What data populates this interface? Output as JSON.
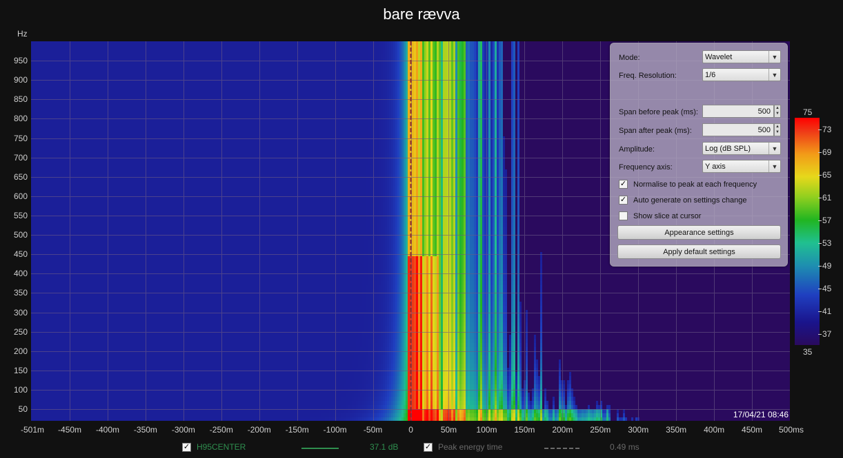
{
  "title": "bare rævva",
  "y_unit": "Hz",
  "timestamp": "17/04/21 08:46",
  "chart_data": {
    "type": "heatmap",
    "title": "bare rævva",
    "xlabel": "",
    "ylabel": "Hz",
    "x_ticks": [
      "-501m",
      "-450m",
      "-400m",
      "-350m",
      "-300m",
      "-250m",
      "-200m",
      "-150m",
      "-100m",
      "-50m",
      "0",
      "50m",
      "100m",
      "150m",
      "200m",
      "250m",
      "300m",
      "350m",
      "400m",
      "450m",
      "500ms"
    ],
    "xlim": [
      -501,
      500
    ],
    "y_ticks": [
      50,
      100,
      150,
      200,
      250,
      300,
      350,
      400,
      450,
      500,
      550,
      600,
      650,
      700,
      750,
      800,
      850,
      900,
      950
    ],
    "ylim": [
      20,
      1000
    ],
    "color_scale": {
      "min": 35,
      "max": 75,
      "ticks": [
        37,
        41,
        45,
        49,
        53,
        57,
        61,
        65,
        69,
        73
      ]
    },
    "grid": true
  },
  "panel": {
    "mode": {
      "label": "Mode:",
      "value": "Wavelet"
    },
    "freq_resolution": {
      "label": "Freq. Resolution:",
      "value": "1/6"
    },
    "span_before": {
      "label": "Span before peak (ms):",
      "value": "500"
    },
    "span_after": {
      "label": "Span after peak (ms):",
      "value": "500"
    },
    "amplitude": {
      "label": "Amplitude:",
      "value": "Log (dB SPL)"
    },
    "freq_axis": {
      "label": "Frequency axis:",
      "value": "Y axis"
    },
    "normalise": {
      "label": "Normalise to peak at each frequency",
      "checked": true
    },
    "auto_generate": {
      "label": "Auto generate on settings change",
      "checked": true
    },
    "show_slice": {
      "label": "Show slice at cursor",
      "checked": false
    },
    "appearance_btn": "Appearance settings",
    "defaults_btn": "Apply default settings"
  },
  "legend": [
    {
      "name": "H95CENTER",
      "value": "37.1 dB",
      "color": "#2f8f4f",
      "style": "solid",
      "checked": true
    },
    {
      "name": "Peak energy time",
      "value": "0.49 ms",
      "color": "#6a6a6a",
      "style": "dashed",
      "checked": true
    }
  ]
}
